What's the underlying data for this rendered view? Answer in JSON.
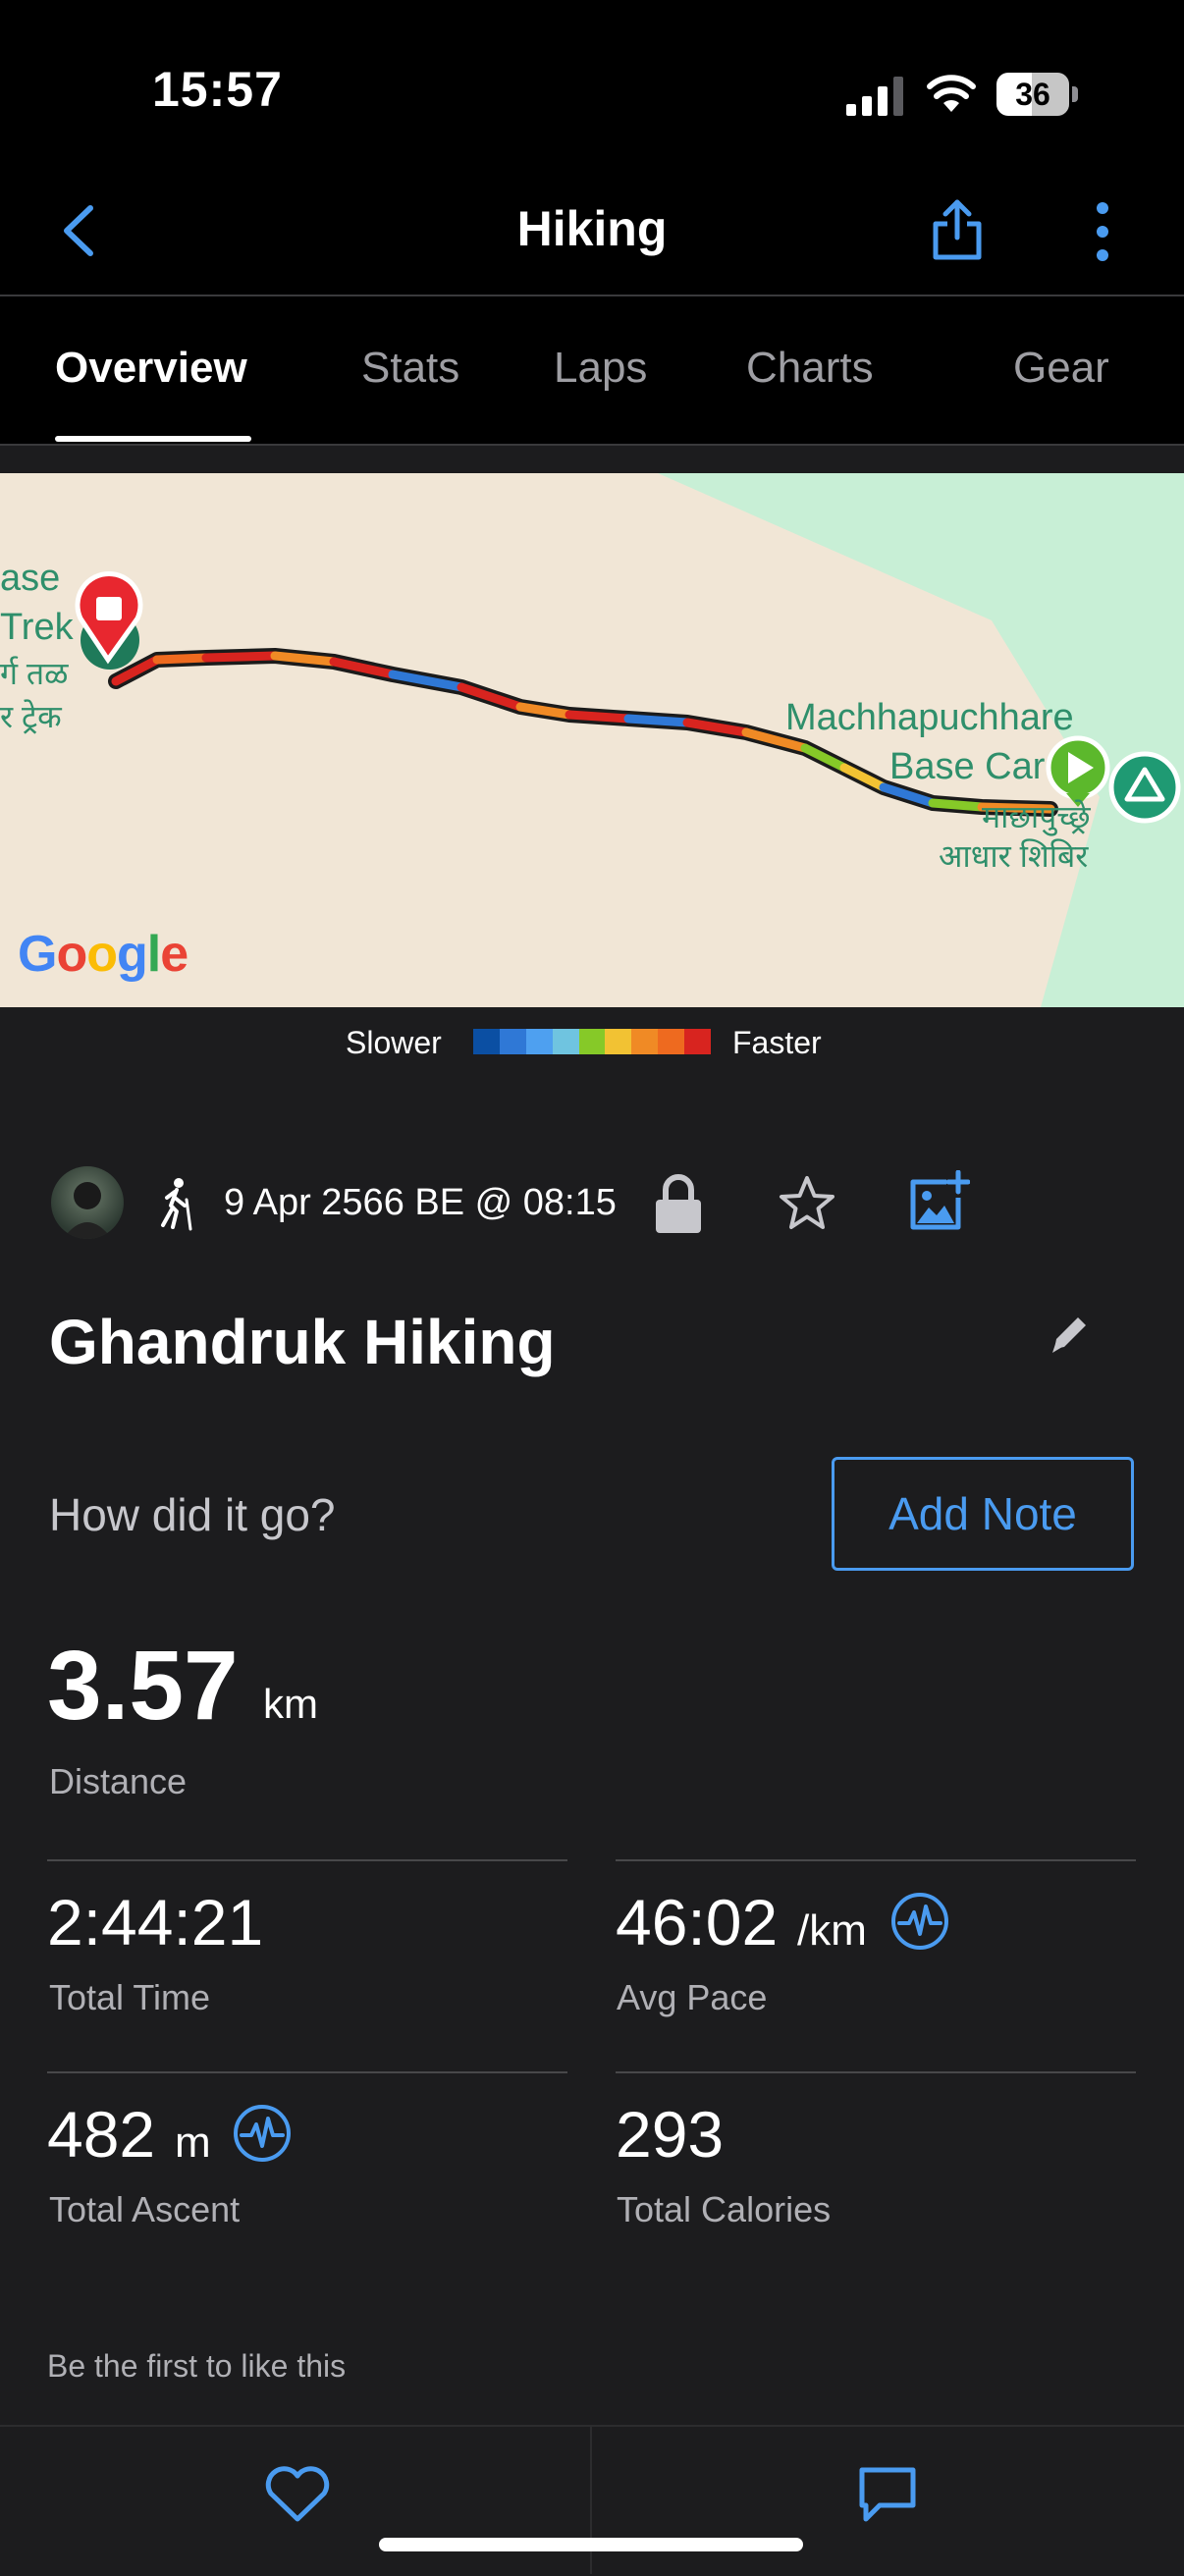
{
  "status_bar": {
    "time": "15:57",
    "battery": "36"
  },
  "nav": {
    "title": "Hiking"
  },
  "tabs": [
    {
      "label": "Overview",
      "active": true
    },
    {
      "label": "Stats",
      "active": false
    },
    {
      "label": "Laps",
      "active": false
    },
    {
      "label": "Charts",
      "active": false
    },
    {
      "label": "Gear",
      "active": false
    }
  ],
  "map": {
    "labels": {
      "left_en_1": "ase",
      "left_en_2": "Trek",
      "left_hi_1": "र्ग तळ",
      "left_hi_2": "र ट्रेक",
      "right_en_1": "Machhapuchhare",
      "right_en_2": "Base Car",
      "right_hi_1": "माछापुच्छ्रे",
      "right_hi_2": "आधार शिबिर"
    },
    "logo_letters": [
      "G",
      "o",
      "o",
      "g",
      "l",
      "e"
    ]
  },
  "legend": {
    "slower": "Slower",
    "faster": "Faster",
    "colors": [
      "#0b4fa3",
      "#2f78d6",
      "#4ea0f0",
      "#6fc4e0",
      "#86c928",
      "#f2c233",
      "#f08a25",
      "#ee6a1f",
      "#d8241f"
    ]
  },
  "activity": {
    "date": "9 Apr 2566 BE @ 08:15",
    "name": "Ghandruk Hiking",
    "prompt": "How did it go?",
    "add_note": "Add Note"
  },
  "stats": {
    "distance": {
      "value": "3.57",
      "unit": "km",
      "label": "Distance"
    },
    "total_time": {
      "value": "2:44:21",
      "label": "Total Time"
    },
    "avg_pace": {
      "value": "46:02",
      "unit": "/km",
      "label": "Avg Pace"
    },
    "total_ascent": {
      "value": "482",
      "unit": "m",
      "label": "Total Ascent"
    },
    "total_calories": {
      "value": "293",
      "label": "Total Calories"
    }
  },
  "social": {
    "likes_text": "Be the first to like this"
  },
  "colors": {
    "accent": "#4a9bf0",
    "map_land": "#f1e6d6",
    "map_green": "#c8efd6",
    "start_marker": "#5cb82c",
    "end_marker": "#e8272f"
  }
}
